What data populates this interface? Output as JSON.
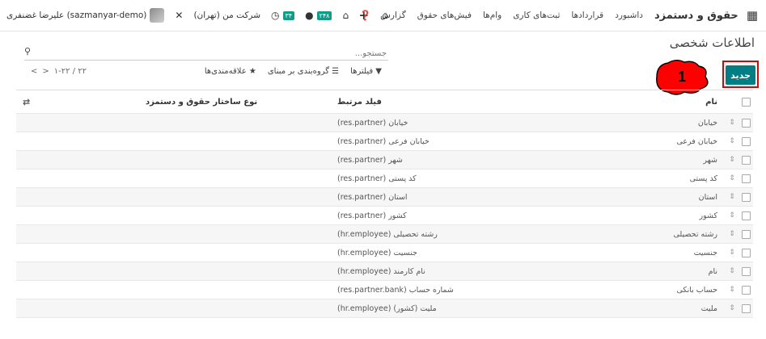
{
  "navbar": {
    "brand": "حقوق و دستمزد",
    "menu": [
      "داشبورد",
      "قراردادها",
      "ثبت‌های کاری",
      "وام‌ها",
      "فیش‌های حقوق",
      "گزارش"
    ],
    "company": "شرکت من (تهران)",
    "user": "علیرضا غضنفری (sazmanyar-demo)",
    "badge_activity": "۲۴۸",
    "badge_clock": "۳۴"
  },
  "page": {
    "title": "اطلاعات شخصی",
    "new_label": "جدید",
    "callout_number": "1"
  },
  "search": {
    "placeholder": "جستجو..."
  },
  "filters": {
    "filters": "فیلترها",
    "group_by": "گروه‌بندی بر مبنای",
    "favorites": "علاقه‌مندی‌ها"
  },
  "pager": {
    "range": "۱-۲۲ / ۲۲"
  },
  "table": {
    "headers": {
      "name": "نام",
      "field": "فیلد مرتبط",
      "type": "نوع ساختار حقوق و دستمزد"
    },
    "rows": [
      {
        "name": "خیابان",
        "field": "خیابان (res.partner)"
      },
      {
        "name": "خیابان فرعی",
        "field": "خیابان فرعی (res.partner)"
      },
      {
        "name": "شهر",
        "field": "شهر (res.partner)"
      },
      {
        "name": "کد پستی",
        "field": "کد پستی (res.partner)"
      },
      {
        "name": "استان",
        "field": "استان (res.partner)"
      },
      {
        "name": "کشور",
        "field": "کشور (res.partner)"
      },
      {
        "name": "رشته تحصیلی",
        "field": "رشته تحصیلی (hr.employee)"
      },
      {
        "name": "جنسیت",
        "field": "جنسیت (hr.employee)"
      },
      {
        "name": "نام",
        "field": "نام کارمند (hr.employee)"
      },
      {
        "name": "حساب بانکی",
        "field": "شماره حساب (res.partner.bank)"
      },
      {
        "name": "ملیت",
        "field": "ملیت (کشور) (hr.employee)"
      }
    ]
  },
  "colors": {
    "accent": "#017e84",
    "highlight": "#e00000",
    "callout": "#ff0000",
    "badge": "#0f9d8a"
  }
}
